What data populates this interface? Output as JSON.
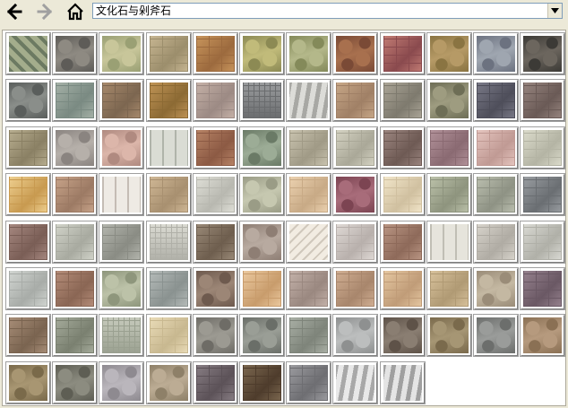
{
  "toolbar": {
    "back_icon": "back-arrow-icon",
    "forward_icon": "forward-arrow-icon",
    "home_icon": "home-icon",
    "address_value": "文化石与剁斧石",
    "dropdown_icon": "chevron-down-icon"
  },
  "textures": [
    {
      "c": "#6c7a62",
      "a": "#a4ad8c",
      "p": "diamond"
    },
    {
      "c": "#5e5c58",
      "a": "#8e8a82",
      "p": "stone"
    },
    {
      "c": "#9aa074",
      "a": "#c8c69a",
      "p": "stone"
    },
    {
      "c": "#9c8e6c",
      "a": "#c7b692",
      "p": "brick"
    },
    {
      "c": "#9c6a3e",
      "a": "#c8955c",
      "p": "brick"
    },
    {
      "c": "#8c8a54",
      "a": "#c1bb7a",
      "p": "stone"
    },
    {
      "c": "#848a5a",
      "a": "#b4b88a",
      "p": "stone"
    },
    {
      "c": "#7a4a36",
      "a": "#a8704e",
      "p": "stone"
    },
    {
      "c": "#8a4a4e",
      "a": "#c27c74",
      "p": "brick"
    },
    {
      "c": "#8a7442",
      "a": "#b69a66",
      "p": "stone"
    },
    {
      "c": "#6c7280",
      "a": "#9fa6b0",
      "p": "stone"
    },
    {
      "c": "#3c3a36",
      "a": "#6c665e",
      "p": "stone"
    },
    {
      "c": "#5a5e5c",
      "a": "#8a8e8a",
      "p": "stone"
    },
    {
      "c": "#7a8a82",
      "a": "#a6b2a8",
      "p": "brick"
    },
    {
      "c": "#7c6650",
      "a": "#a88a6c",
      "p": "brick"
    },
    {
      "c": "#8c6a34",
      "a": "#c09456",
      "p": "brick"
    },
    {
      "c": "#9c8a84",
      "a": "#c6b2a8",
      "p": "brick"
    },
    {
      "c": "#6a6c6e",
      "a": "#9a9c9e",
      "p": "grid"
    },
    {
      "c": "#a8a8a4",
      "a": "#dcdcd8",
      "p": "wave"
    },
    {
      "c": "#a08066",
      "a": "#c8a888",
      "p": "brick"
    },
    {
      "c": "#7e7a6e",
      "a": "#aca698",
      "p": "brick"
    },
    {
      "c": "#6e6e56",
      "a": "#9e9c80",
      "p": "stone"
    },
    {
      "c": "#4e4e5a",
      "a": "#7a7a88",
      "p": "brick"
    },
    {
      "c": "#6a5a56",
      "a": "#988680",
      "p": "brick"
    },
    {
      "c": "#8a8064",
      "a": "#b8ae90",
      "p": "brick"
    },
    {
      "c": "#8a8480",
      "a": "#b6b0aa",
      "p": "stone"
    },
    {
      "c": "#b08a80",
      "a": "#dcb6aa",
      "p": "stone"
    },
    {
      "c": "#b0b4aa",
      "a": "#dadcd4",
      "p": "vline"
    },
    {
      "c": "#8c5a44",
      "a": "#b88466",
      "p": "brick"
    },
    {
      "c": "#6a7a66",
      "a": "#9cac96",
      "p": "stone"
    },
    {
      "c": "#a09a86",
      "a": "#cac4b0",
      "p": "brick"
    },
    {
      "c": "#aaa898",
      "a": "#d6d4c4",
      "p": "brick"
    },
    {
      "c": "#6e5a54",
      "a": "#9c8680",
      "p": "brick"
    },
    {
      "c": "#8a6a72",
      "a": "#b2929a",
      "p": "brick"
    },
    {
      "c": "#c09a94",
      "a": "#e6c6c0",
      "p": "brick"
    },
    {
      "c": "#b4b4a4",
      "a": "#dcdccc",
      "p": "brick"
    },
    {
      "c": "#c89a50",
      "a": "#efd090",
      "p": "brick"
    },
    {
      "c": "#9c7a64",
      "a": "#c8a48a",
      "p": "brick"
    },
    {
      "c": "#c4bcb4",
      "a": "#eeeae4",
      "p": "vline"
    },
    {
      "c": "#a89070",
      "a": "#d0b896",
      "p": "brick"
    },
    {
      "c": "#b8b8b0",
      "a": "#e0e0d8",
      "p": "brick"
    },
    {
      "c": "#9a9c86",
      "a": "#c6c8b0",
      "p": "stone"
    },
    {
      "c": "#c8aa86",
      "a": "#ecd2b0",
      "p": "brick"
    },
    {
      "c": "#7c4452",
      "a": "#a86c7a",
      "p": "stone"
    },
    {
      "c": "#d0c0a0",
      "a": "#f2e6ca",
      "p": "brick"
    },
    {
      "c": "#8e947e",
      "a": "#bcc2aa",
      "p": "brick"
    },
    {
      "c": "#8e9284",
      "a": "#bcc0b0",
      "p": "brick"
    },
    {
      "c": "#6a6e72",
      "a": "#9a9ea2",
      "p": "brick"
    },
    {
      "c": "#7a5e56",
      "a": "#a68880",
      "p": "brick"
    },
    {
      "c": "#a8aaa0",
      "a": "#d2d4ca",
      "p": "brick"
    },
    {
      "c": "#8a8c84",
      "a": "#b4b6ae",
      "p": "brick"
    },
    {
      "c": "#b0b0a8",
      "a": "#dadad2",
      "p": "grid"
    },
    {
      "c": "#6e5e4e",
      "a": "#9a8a78",
      "p": "brick"
    },
    {
      "c": "#8e7e74",
      "a": "#b8aaa0",
      "p": "stone"
    },
    {
      "c": "#d0c8bc",
      "a": "#f2ece2",
      "p": "diag"
    },
    {
      "c": "#b8b0ac",
      "a": "#e0dad6",
      "p": "brick"
    },
    {
      "c": "#8e6a5a",
      "a": "#ba9684",
      "p": "brick"
    },
    {
      "c": "#c0beb4",
      "a": "#e6e4dc",
      "p": "vline"
    },
    {
      "c": "#b0aca4",
      "a": "#d8d4cc",
      "p": "brick"
    },
    {
      "c": "#b0b0a8",
      "a": "#dadad4",
      "p": "brick"
    },
    {
      "c": "#a8aca8",
      "a": "#d2d6d2",
      "p": "brick"
    },
    {
      "c": "#8a6654",
      "a": "#b68e7a",
      "p": "brick"
    },
    {
      "c": "#8e967c",
      "a": "#bcc2a8",
      "p": "stone"
    },
    {
      "c": "#8a9290",
      "a": "#b6bcba",
      "p": "brick"
    },
    {
      "c": "#6e5a4e",
      "a": "#9c8676",
      "p": "stone"
    },
    {
      "c": "#c89c6c",
      "a": "#eccaa0",
      "p": "brick"
    },
    {
      "c": "#9a8880",
      "a": "#c4b2aa",
      "p": "brick"
    },
    {
      "c": "#a8866c",
      "a": "#d2b094",
      "p": "brick"
    },
    {
      "c": "#c09c78",
      "a": "#e6c8a2",
      "p": "brick"
    },
    {
      "c": "#b09a74",
      "a": "#d8c29c",
      "p": "brick"
    },
    {
      "c": "#9a8c78",
      "a": "#c4b8a2",
      "p": "stone"
    },
    {
      "c": "#6a5864",
      "a": "#96828e",
      "p": "brick"
    },
    {
      "c": "#7a6450",
      "a": "#a88e78",
      "p": "brick"
    },
    {
      "c": "#7a8070",
      "a": "#a6ac9c",
      "p": "brick"
    },
    {
      "c": "#9aa090",
      "a": "#c6cabc",
      "p": "grid"
    },
    {
      "c": "#c8b890",
      "a": "#eadcb8",
      "p": "brick"
    },
    {
      "c": "#6e6c66",
      "a": "#9c9a92",
      "p": "stone"
    },
    {
      "c": "#6a6e68",
      "a": "#9a9e96",
      "p": "stone"
    },
    {
      "c": "#7e847a",
      "a": "#aab0a6",
      "p": "brick"
    },
    {
      "c": "#8e9090",
      "a": "#bcbebe",
      "p": "stone"
    },
    {
      "c": "#5e5248",
      "a": "#8a7e72",
      "p": "stone"
    },
    {
      "c": "#7a6a4c",
      "a": "#a69674",
      "p": "stone"
    },
    {
      "c": "#6c6e6c",
      "a": "#9a9c9a",
      "p": "stone"
    },
    {
      "c": "#8a7054",
      "a": "#b69a7e",
      "p": "stone"
    },
    {
      "c": "#7a6a4a",
      "a": "#a89672",
      "p": "stone"
    },
    {
      "c": "#5e5e54",
      "a": "#8c8c80",
      "p": "stone"
    },
    {
      "c": "#8e8a90",
      "a": "#bab6bc",
      "p": "stone"
    },
    {
      "c": "#8e8068",
      "a": "#bcac94",
      "p": "stone"
    },
    {
      "c": "#5c5258",
      "a": "#887e84",
      "p": "brick"
    },
    {
      "c": "#4e3c2c",
      "a": "#7c6850",
      "p": "brick"
    },
    {
      "c": "#6e6e72",
      "a": "#9c9ca0",
      "p": "brick"
    },
    {
      "c": "#a8a8a8",
      "a": "#e8e8e8",
      "p": "wave"
    },
    {
      "c": "#a0a0a0",
      "a": "#e4e4e4",
      "p": "wave"
    }
  ]
}
